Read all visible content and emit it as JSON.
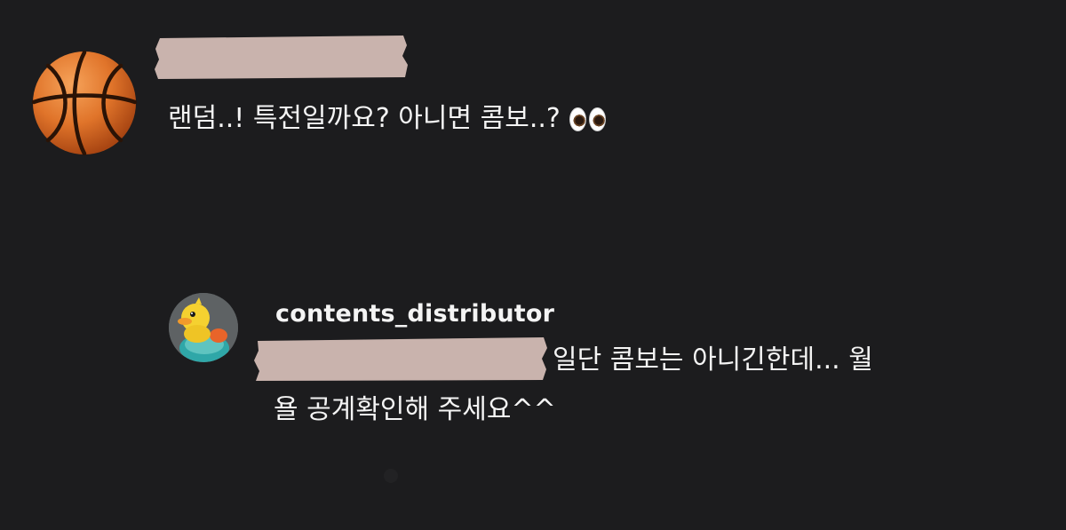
{
  "comment": {
    "avatar_icon": "basketball-icon",
    "message": "랜덤..! 특전일까요? 아니면 콤보..?",
    "emoji": "eyes-emoji-icon",
    "censor_color": "#c9b3ad"
  },
  "reply": {
    "avatar_icon": "duck-avatar-icon",
    "username": "contents_distributor",
    "line1": "일단 콤보는 아니긴한데... 월",
    "line2": "욜 공계확인해 주세요^^",
    "censor_color": "#c9b3ad"
  },
  "colors": {
    "background": "#1c1c1e",
    "text": "#f4f4f4"
  }
}
